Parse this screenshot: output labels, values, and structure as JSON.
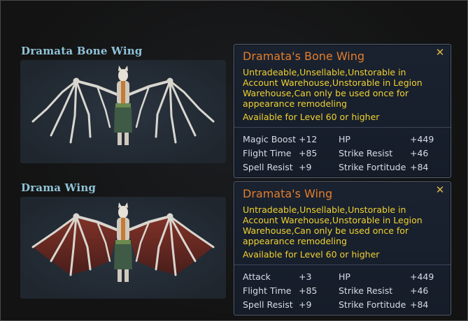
{
  "wings": [
    {
      "title": "Dramata Bone Wing",
      "tooltip": {
        "name": "Dramata's Bone Wing",
        "description": "Untradeable,Unsellable,Unstorable in Account Warehouse,Unstorable in Legion Warehouse,Can only be used once for appearance remodeling",
        "level": "Available for Level 60 or higher",
        "close_icon": "close-icon",
        "stats_left": [
          {
            "label": "Magic Boost",
            "value": "+12"
          },
          {
            "label": "Flight Time",
            "value": "+85"
          },
          {
            "label": "Spell Resist",
            "value": "+9"
          }
        ],
        "stats_right": [
          {
            "label": "HP",
            "value": "+449"
          },
          {
            "label": "Strike Resist",
            "value": "+46"
          },
          {
            "label": "Strike Fortitude",
            "value": "+84"
          }
        ]
      }
    },
    {
      "title": "Drama Wing",
      "tooltip": {
        "name": "Dramata's Wing",
        "description": "Untradeable,Unsellable,Unstorable in Account Warehouse,Unstorable in Legion Warehouse,Can only be used once for appearance remodeling",
        "level": "Available for Level 60 or higher",
        "close_icon": "close-icon",
        "stats_left": [
          {
            "label": "Attack",
            "value": "+3"
          },
          {
            "label": "Flight Time",
            "value": "+85"
          },
          {
            "label": "Spell Resist",
            "value": "+9"
          }
        ],
        "stats_right": [
          {
            "label": "HP",
            "value": "+449"
          },
          {
            "label": "Strike Resist",
            "value": "+46"
          },
          {
            "label": "Strike Fortitude",
            "value": "+84"
          }
        ]
      }
    }
  ],
  "colors": {
    "item_name": "#e67d2a",
    "description": "#f0d232",
    "title": "#8fc3d8",
    "bone": "#d8d6cf",
    "membrane": "#7a2a22"
  }
}
